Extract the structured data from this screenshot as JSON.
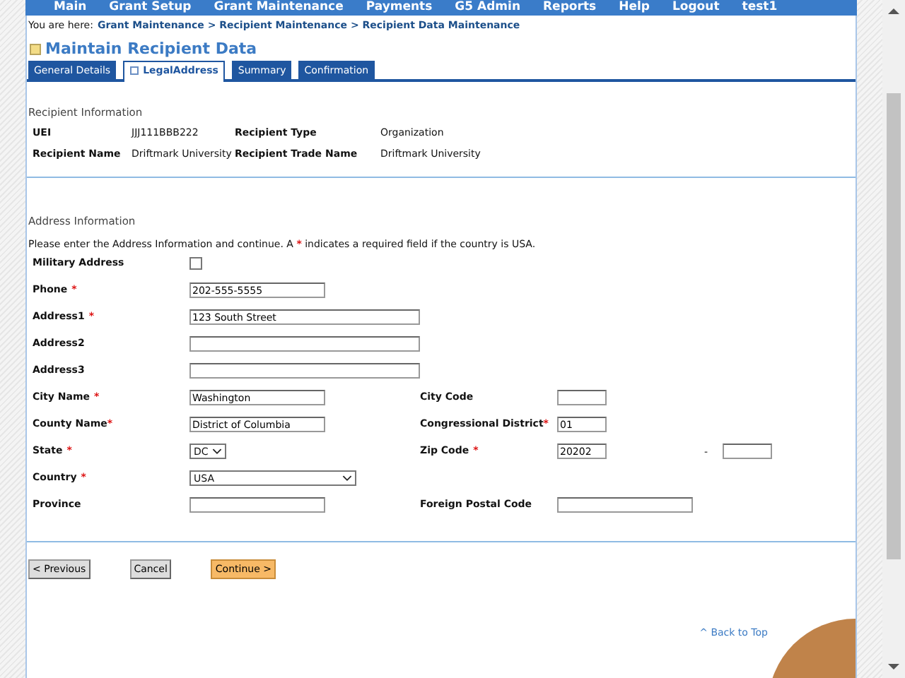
{
  "nav": {
    "items": [
      "Main",
      "Grant Setup",
      "Grant Maintenance",
      "Payments",
      "G5 Admin",
      "Reports",
      "Help",
      "Logout",
      "test1"
    ]
  },
  "breadcrumb": {
    "prefix": "You are here:",
    "path": "Grant Maintenance > Recipient Maintenance > Recipient Data Maintenance"
  },
  "page_title": "Maintain Recipient Data",
  "tabs": [
    {
      "label": "General Details",
      "selected": false
    },
    {
      "label": "LegalAddress",
      "selected": true
    },
    {
      "label": "Summary",
      "selected": false
    },
    {
      "label": "Confirmation",
      "selected": false
    }
  ],
  "recipient_info": {
    "heading": "Recipient Information",
    "rows": [
      [
        {
          "label": "UEI",
          "value": "JJJ111BBB222"
        },
        {
          "label": "Recipient Type",
          "value": "Organization"
        }
      ],
      [
        {
          "label": "Recipient Name",
          "value": "Driftmark University"
        },
        {
          "label": "Recipient Trade Name",
          "value": "Driftmark University"
        }
      ]
    ]
  },
  "address_info": {
    "heading": "Address Information",
    "instructions": {
      "before": "Please enter the Address Information and continue. A",
      "mark": "*",
      "after": "indicates a required field if the country is USA."
    },
    "rows": [
      {
        "left": {
          "label": "Military Address",
          "kind": "checkbox",
          "checked": false
        }
      },
      {
        "left": {
          "label": "Phone",
          "required_mark": "*",
          "kind": "text",
          "value": "202-555-5555"
        }
      },
      {
        "left": {
          "label": "Address1",
          "required_mark": "*",
          "kind": "wide",
          "value": "123 South Street"
        }
      },
      {
        "left": {
          "label": "Address2",
          "kind": "wide"
        }
      },
      {
        "left": {
          "label": "Address3",
          "kind": "wide"
        }
      },
      {
        "left": {
          "label": "City Name",
          "required_mark": "*",
          "kind": "text",
          "value": "Washington"
        },
        "right": {
          "label": "City Code",
          "kind": "short"
        }
      },
      {
        "left": {
          "label": "County Name",
          "required_mark": "*",
          "tight": true,
          "kind": "text",
          "value": "District of Columbia"
        },
        "right": {
          "label": "Congressional District",
          "required_mark": "*",
          "tight": true,
          "kind": "short",
          "value": "01"
        }
      },
      {
        "left": {
          "label": "State",
          "required_mark": "*",
          "kind": "select-small",
          "value": "DC"
        },
        "right": {
          "label": "Zip Code",
          "required_mark": "*",
          "kind": "short",
          "value": "20202",
          "extension": {
            "separator": "-"
          }
        }
      },
      {
        "left": {
          "label": "Country",
          "required_mark": "*",
          "kind": "select",
          "value": "USA"
        }
      },
      {
        "left": {
          "label": "Province",
          "kind": "text"
        },
        "right": {
          "label": "Foreign Postal Code",
          "kind": "text"
        }
      }
    ]
  },
  "buttons": [
    {
      "label": "< Previous",
      "kind": "default"
    },
    {
      "label": "Cancel",
      "kind": "default"
    },
    {
      "label": "Continue >",
      "kind": "primary"
    }
  ],
  "back_to_top": "^ Back to Top"
}
